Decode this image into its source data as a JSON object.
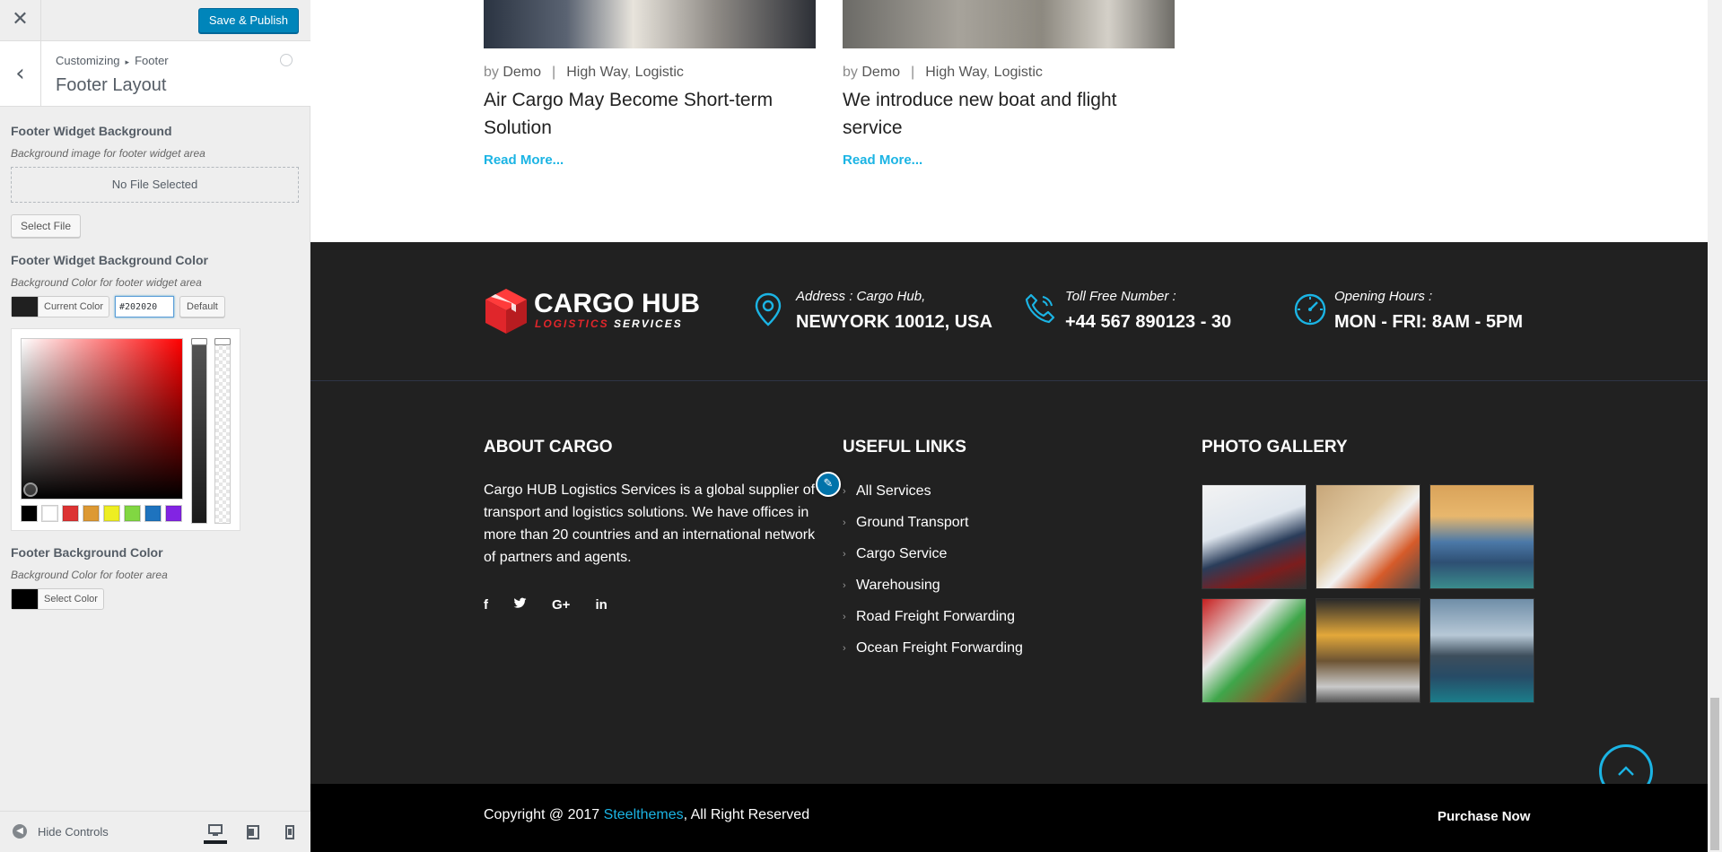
{
  "customizer": {
    "close_icon": "close-icon",
    "publish_label": "Save & Publish",
    "breadcrumb_parent": "Customizing",
    "breadcrumb_section": "Footer",
    "section_title": "Footer Layout",
    "widget_bg": {
      "title": "Footer Widget Background",
      "description": "Background image for footer widget area",
      "placeholder": "No File Selected",
      "select_label": "Select File"
    },
    "widget_bg_color": {
      "title": "Footer Widget Background Color",
      "description": "Background Color for footer widget area",
      "current_label": "Current Color",
      "hex_value": "#202020",
      "default_label": "Default",
      "swatch_color": "#202020",
      "palette": [
        "#000000",
        "#ffffff",
        "#dd3333",
        "#dd9933",
        "#eeee22",
        "#81d742",
        "#1e73be",
        "#8224e3"
      ]
    },
    "footer_bg_color": {
      "title": "Footer Background Color",
      "description": "Background Color for footer area",
      "select_label": "Select Color",
      "swatch_color": "#000000"
    },
    "hide_controls_label": "Hide Controls"
  },
  "posts": [
    {
      "by": "by",
      "author": "Demo",
      "cat1": "High Way",
      "cat2": "Logistic",
      "title": "Air Cargo May Become Short-term Solution",
      "more": "Read More..."
    },
    {
      "by": "by",
      "author": "Demo",
      "cat1": "High Way",
      "cat2": "Logistic",
      "title": "We introduce new boat and flight service",
      "more": "Read More..."
    }
  ],
  "footer": {
    "logo_main": "CARGO HUB",
    "logo_sub_red": "LOGISTICS",
    "logo_sub_white": "SERVICES",
    "info": [
      {
        "icon": "location-pin-icon",
        "label": "Address : Cargo Hub,",
        "value": "NEWYORK 10012, USA"
      },
      {
        "icon": "phone-icon",
        "label": "Toll Free Number :",
        "value": "+44 567 890123 - 30"
      },
      {
        "icon": "clock-icon",
        "label": "Opening Hours :",
        "value": "MON - FRI: 8AM - 5PM"
      }
    ],
    "about_title": "ABOUT CARGO",
    "about_text": "Cargo HUB Logistics Services is a global supplier of transport and logistics solutions. We have offices in more than 20 countries and an international network of partners and agents.",
    "social": [
      "f",
      "t",
      "G+",
      "in"
    ],
    "links_title": "USEFUL LINKS",
    "links": [
      "All Services",
      "Ground Transport",
      "Cargo Service",
      "Warehousing",
      "Road Freight Forwarding",
      "Ocean Freight Forwarding"
    ],
    "gallery_title": "PHOTO GALLERY",
    "copyright_prefix": "Copyright @ 2017 ",
    "copyright_link": "Steelthemes",
    "copyright_suffix": ", All Right Reserved",
    "purchase": "Purchase Now"
  },
  "colors": {
    "accent": "#1bb4e4",
    "wp_primary": "#0085ba",
    "footer_bg": "#212121",
    "bottom_bar": "#000000",
    "logo_red": "#e0262b"
  }
}
